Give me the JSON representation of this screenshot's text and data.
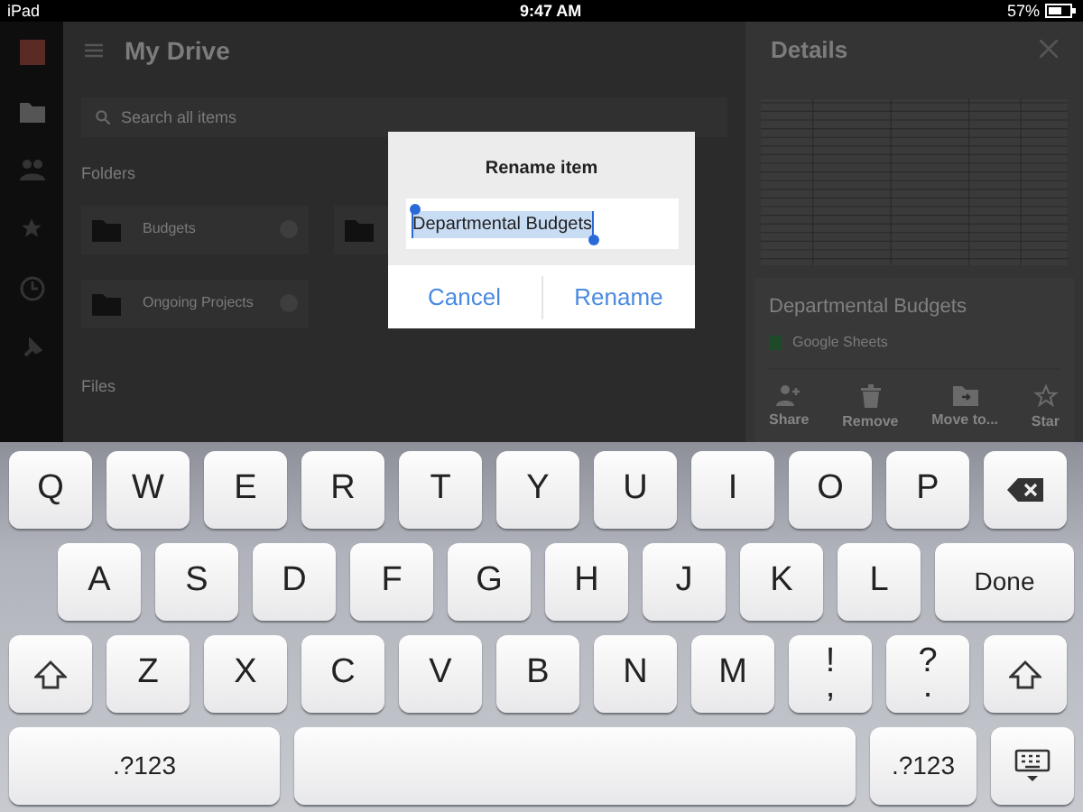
{
  "status_bar": {
    "device": "iPad",
    "time": "9:47 AM",
    "battery": "57%"
  },
  "drive": {
    "title": "My Drive",
    "search": {
      "placeholder": "Search all items"
    },
    "folders_heading": "Folders",
    "folders": [
      {
        "name": "Budgets"
      },
      {
        "name": "Ongoing Projects"
      }
    ],
    "files_heading": "Files"
  },
  "details": {
    "title": "Details",
    "file_name": "Departmental Budgets",
    "file_type": "Google Sheets",
    "actions": [
      {
        "label": "Share",
        "kind": "share"
      },
      {
        "label": "Remove",
        "kind": "remove"
      },
      {
        "label": "Move to...",
        "kind": "move"
      },
      {
        "label": "Star",
        "kind": "star"
      }
    ]
  },
  "dialog": {
    "title": "Rename item",
    "value": "Departmental Budgets",
    "selected": true,
    "buttons": [
      {
        "label": "Cancel"
      },
      {
        "label": "Rename"
      }
    ]
  },
  "keyboard": {
    "rows": [
      {
        "keys": [
          {
            "label": "Q"
          },
          {
            "label": "W"
          },
          {
            "label": "E"
          },
          {
            "label": "R"
          },
          {
            "label": "T"
          },
          {
            "label": "Y"
          },
          {
            "label": "U"
          },
          {
            "label": "I"
          },
          {
            "label": "O"
          },
          {
            "label": "P"
          },
          {
            "kind": "backspace"
          }
        ]
      },
      {
        "keys": [
          {
            "label": "A"
          },
          {
            "label": "S"
          },
          {
            "label": "D"
          },
          {
            "label": "F"
          },
          {
            "label": "G"
          },
          {
            "label": "H"
          },
          {
            "label": "J"
          },
          {
            "label": "K"
          },
          {
            "label": "L"
          },
          {
            "label": "Done",
            "kind": "wide"
          }
        ]
      },
      {
        "keys": [
          {
            "kind": "shift"
          },
          {
            "label": "Z"
          },
          {
            "label": "X"
          },
          {
            "label": "C"
          },
          {
            "label": "V"
          },
          {
            "label": "B"
          },
          {
            "label": "N"
          },
          {
            "label": "M"
          },
          {
            "label": "!",
            "sub": ","
          },
          {
            "label": "?",
            "sub": "."
          },
          {
            "kind": "shift"
          }
        ]
      },
      {
        "keys": [
          {
            "label": ".?123",
            "kind": "mode"
          },
          {
            "kind": "space"
          },
          {
            "label": ".?123",
            "kind": "mode2"
          },
          {
            "kind": "hide"
          }
        ]
      }
    ]
  }
}
